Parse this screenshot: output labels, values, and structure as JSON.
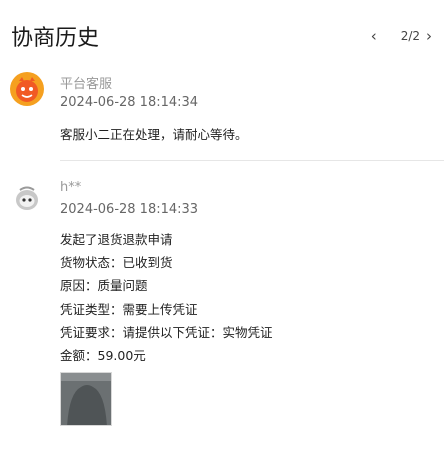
{
  "header": {
    "title": "协商历史",
    "page_indicator": "2/2",
    "prev_icon": "chevron-left-icon",
    "next_icon": "chevron-right-icon"
  },
  "records": [
    {
      "avatar_icon": "platform-service-avatar-icon",
      "name": "平台客服",
      "time": "2024-06-28 18:14:34",
      "message": "客服小二正在处理，请耐心等待。"
    },
    {
      "avatar_icon": "user-avatar-icon",
      "name": "h**",
      "time": "2024-06-28 18:14:33",
      "lines": [
        "发起了退货退款申请",
        "货物状态：已收到货",
        "原因：质量问题",
        "凭证类型：需要上传凭证",
        "凭证要求：请提供以下凭证：实物凭证",
        "金额：59.00元"
      ],
      "attachment": "evidence-photo"
    }
  ],
  "colors": {
    "avatar_orange": "#f5a020",
    "avatar_face": "#f15a24",
    "divider": "#e6e6e6"
  }
}
